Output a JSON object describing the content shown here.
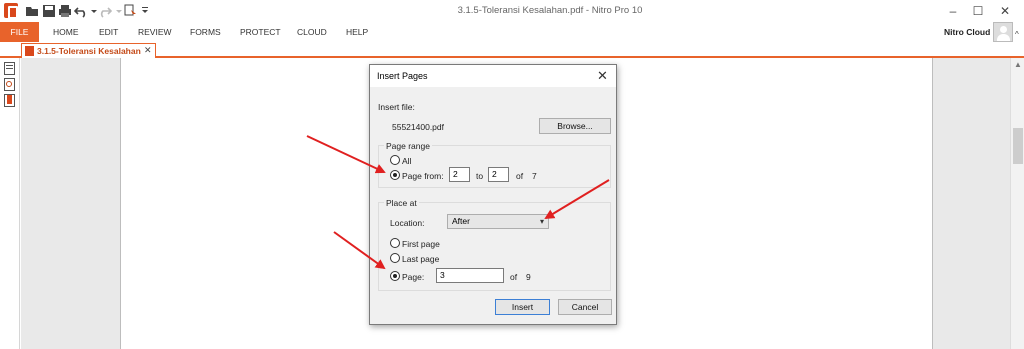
{
  "window": {
    "title": "3.1.5-Toleransi Kesalahan.pdf - Nitro Pro 10",
    "minimize": "–",
    "maximize": "☐",
    "close": "✕"
  },
  "ribbon": {
    "file": "FILE",
    "tabs": [
      "HOME",
      "EDIT",
      "REVIEW",
      "FORMS",
      "PROTECT",
      "CLOUD",
      "HELP"
    ],
    "account": "Nitro Cloud",
    "collapse": "^"
  },
  "document_tab": {
    "label": "3.1.5-Toleransi Kesalahan",
    "close": "✕"
  },
  "dialog": {
    "title": "Insert Pages",
    "close": "✕",
    "insert_file_label": "Insert file:",
    "file_name": "55521400.pdf",
    "browse_button": "Browse...",
    "page_range": {
      "heading": "Page range",
      "all_label": "All",
      "page_from_label": "Page from:",
      "from_value": "2",
      "to_label": "to",
      "to_value": "2",
      "of_label": "of",
      "total": "7",
      "selected": "page_from"
    },
    "place_at": {
      "heading": "Place at",
      "location_label": "Location:",
      "location_value": "After",
      "first_page_label": "First page",
      "last_page_label": "Last page",
      "page_label": "Page:",
      "page_value": "3",
      "of_label": "of",
      "total": "9",
      "selected": "page"
    },
    "insert_button": "Insert",
    "cancel_button": "Cancel"
  },
  "colors": {
    "accent": "#e8632b",
    "arrow": "#e02020",
    "workspace": "#e9e9e9"
  }
}
